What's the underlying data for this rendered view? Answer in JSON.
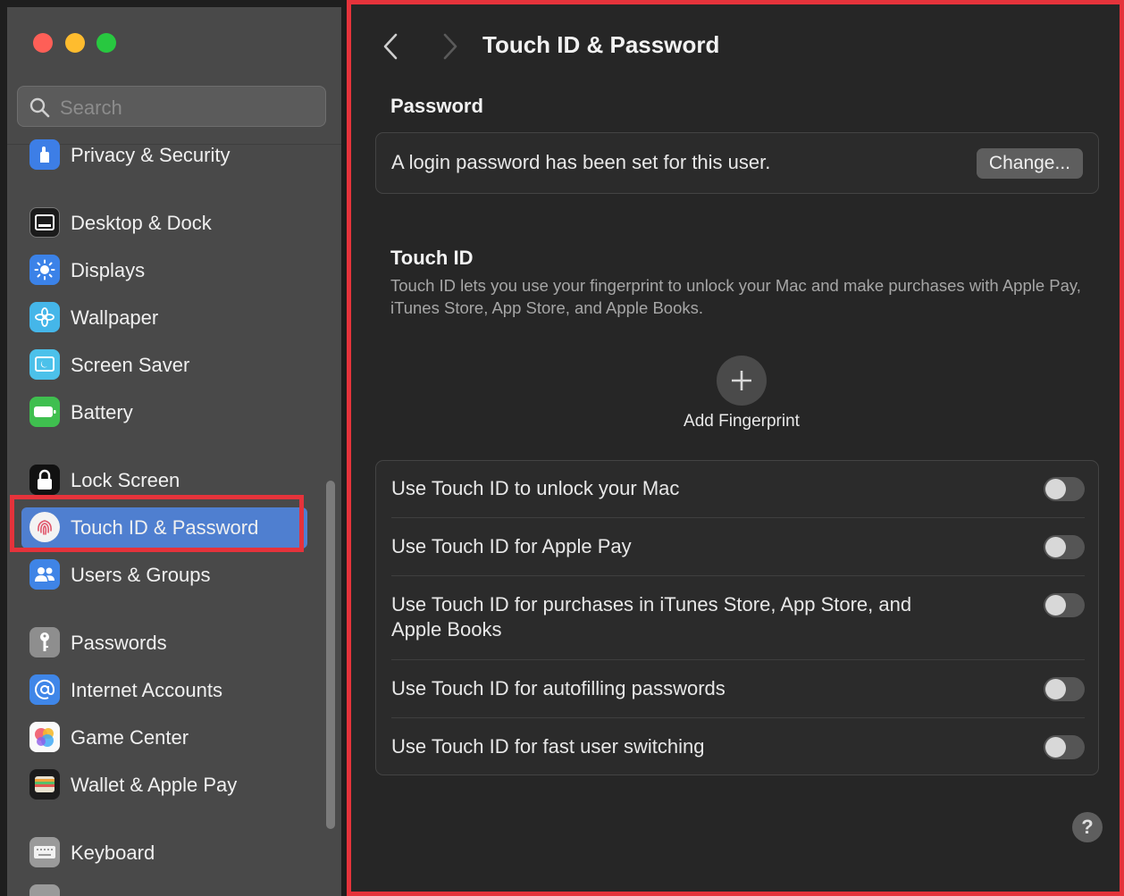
{
  "window": {
    "title": "Touch ID & Password"
  },
  "colors": {
    "close": "#fe5f57",
    "minimize": "#febc2e",
    "zoom": "#28c840",
    "selection": "#4f7fd0",
    "highlight_outline": "#e5333b"
  },
  "sidebar": {
    "search_placeholder": "Search",
    "items": [
      {
        "label": "Privacy & Security",
        "icon": "hand-icon"
      },
      {
        "label": "Desktop & Dock",
        "icon": "dock-icon"
      },
      {
        "label": "Displays",
        "icon": "sun-icon"
      },
      {
        "label": "Wallpaper",
        "icon": "flower-icon"
      },
      {
        "label": "Screen Saver",
        "icon": "screen-saver-icon"
      },
      {
        "label": "Battery",
        "icon": "battery-icon"
      },
      {
        "label": "Lock Screen",
        "icon": "lock-icon"
      },
      {
        "label": "Touch ID & Password",
        "icon": "fingerprint-icon",
        "selected": true
      },
      {
        "label": "Users & Groups",
        "icon": "users-icon"
      },
      {
        "label": "Passwords",
        "icon": "key-icon"
      },
      {
        "label": "Internet Accounts",
        "icon": "at-icon"
      },
      {
        "label": "Game Center",
        "icon": "game-center-icon"
      },
      {
        "label": "Wallet & Apple Pay",
        "icon": "wallet-icon"
      },
      {
        "label": "Keyboard",
        "icon": "keyboard-icon"
      }
    ]
  },
  "main": {
    "title": "Touch ID & Password",
    "password_section": {
      "heading": "Password",
      "status_text": "A login password has been set for this user.",
      "change_button": "Change..."
    },
    "touch_id_section": {
      "heading": "Touch ID",
      "description": "Touch ID lets you use your fingerprint to unlock your Mac and make purchases with Apple Pay, iTunes Store, App Store, and Apple Books.",
      "add_fingerprint_label": "Add Fingerprint",
      "options": [
        {
          "label": "Use Touch ID to unlock your Mac",
          "enabled": false
        },
        {
          "label": "Use Touch ID for Apple Pay",
          "enabled": false
        },
        {
          "label": "Use Touch ID for purchases in iTunes Store, App Store, and Apple Books",
          "enabled": false
        },
        {
          "label": "Use Touch ID for autofilling passwords",
          "enabled": false
        },
        {
          "label": "Use Touch ID for fast user switching",
          "enabled": false
        }
      ]
    },
    "help_label": "?"
  }
}
